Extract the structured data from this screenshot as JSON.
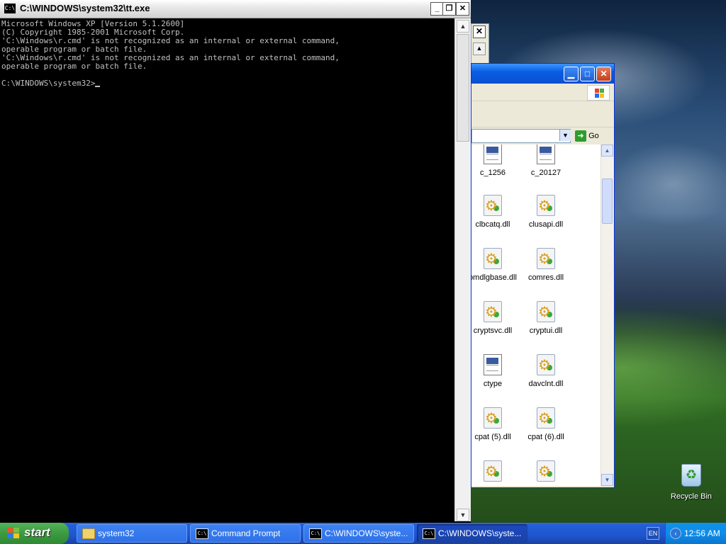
{
  "desktop": {
    "recycle_bin_label": "Recycle Bin"
  },
  "explorer": {
    "go_label": "Go",
    "files": [
      {
        "name": "c_1256",
        "type": "doc"
      },
      {
        "name": "c_20127",
        "type": "doc"
      },
      {
        "name": "clbcatq.dll",
        "type": "dll"
      },
      {
        "name": "clusapi.dll",
        "type": "dll"
      },
      {
        "name": "omdlgbase.dll",
        "type": "dll"
      },
      {
        "name": "comres.dll",
        "type": "dll"
      },
      {
        "name": "cryptsvc.dll",
        "type": "dll"
      },
      {
        "name": "cryptui.dll",
        "type": "dll"
      },
      {
        "name": "ctype",
        "type": "doc"
      },
      {
        "name": "davclnt.dll",
        "type": "dll"
      },
      {
        "name": "cpat (5).dll",
        "type": "dll"
      },
      {
        "name": "cpat (6).dll",
        "type": "dll"
      },
      {
        "name": "",
        "type": "dll"
      },
      {
        "name": "",
        "type": "dll"
      }
    ]
  },
  "cmd": {
    "title": "C:\\WINDOWS\\system32\\tt.exe",
    "icon_text": "C:\\",
    "lines": [
      "Microsoft Windows XP [Version 5.1.2600]",
      "(C) Copyright 1985-2001 Microsoft Corp.",
      "'C:\\Windows\\r.cmd' is not recognized as an internal or external command,",
      "operable program or batch file.",
      "'C:\\Windows\\r.cmd' is not recognized as an internal or external command,",
      "operable program or batch file.",
      "",
      "C:\\WINDOWS\\system32>"
    ]
  },
  "taskbar": {
    "start_label": "start",
    "tasks": [
      {
        "label": "system32",
        "icon": "folder-icon"
      },
      {
        "label": "Command Prompt",
        "icon": "cmd-icon"
      },
      {
        "label": "C:\\WINDOWS\\syste...",
        "icon": "cmd-icon"
      },
      {
        "label": "C:\\WINDOWS\\syste...",
        "icon": "cmd-icon"
      }
    ],
    "language": "EN",
    "clock": "12:56 AM"
  }
}
